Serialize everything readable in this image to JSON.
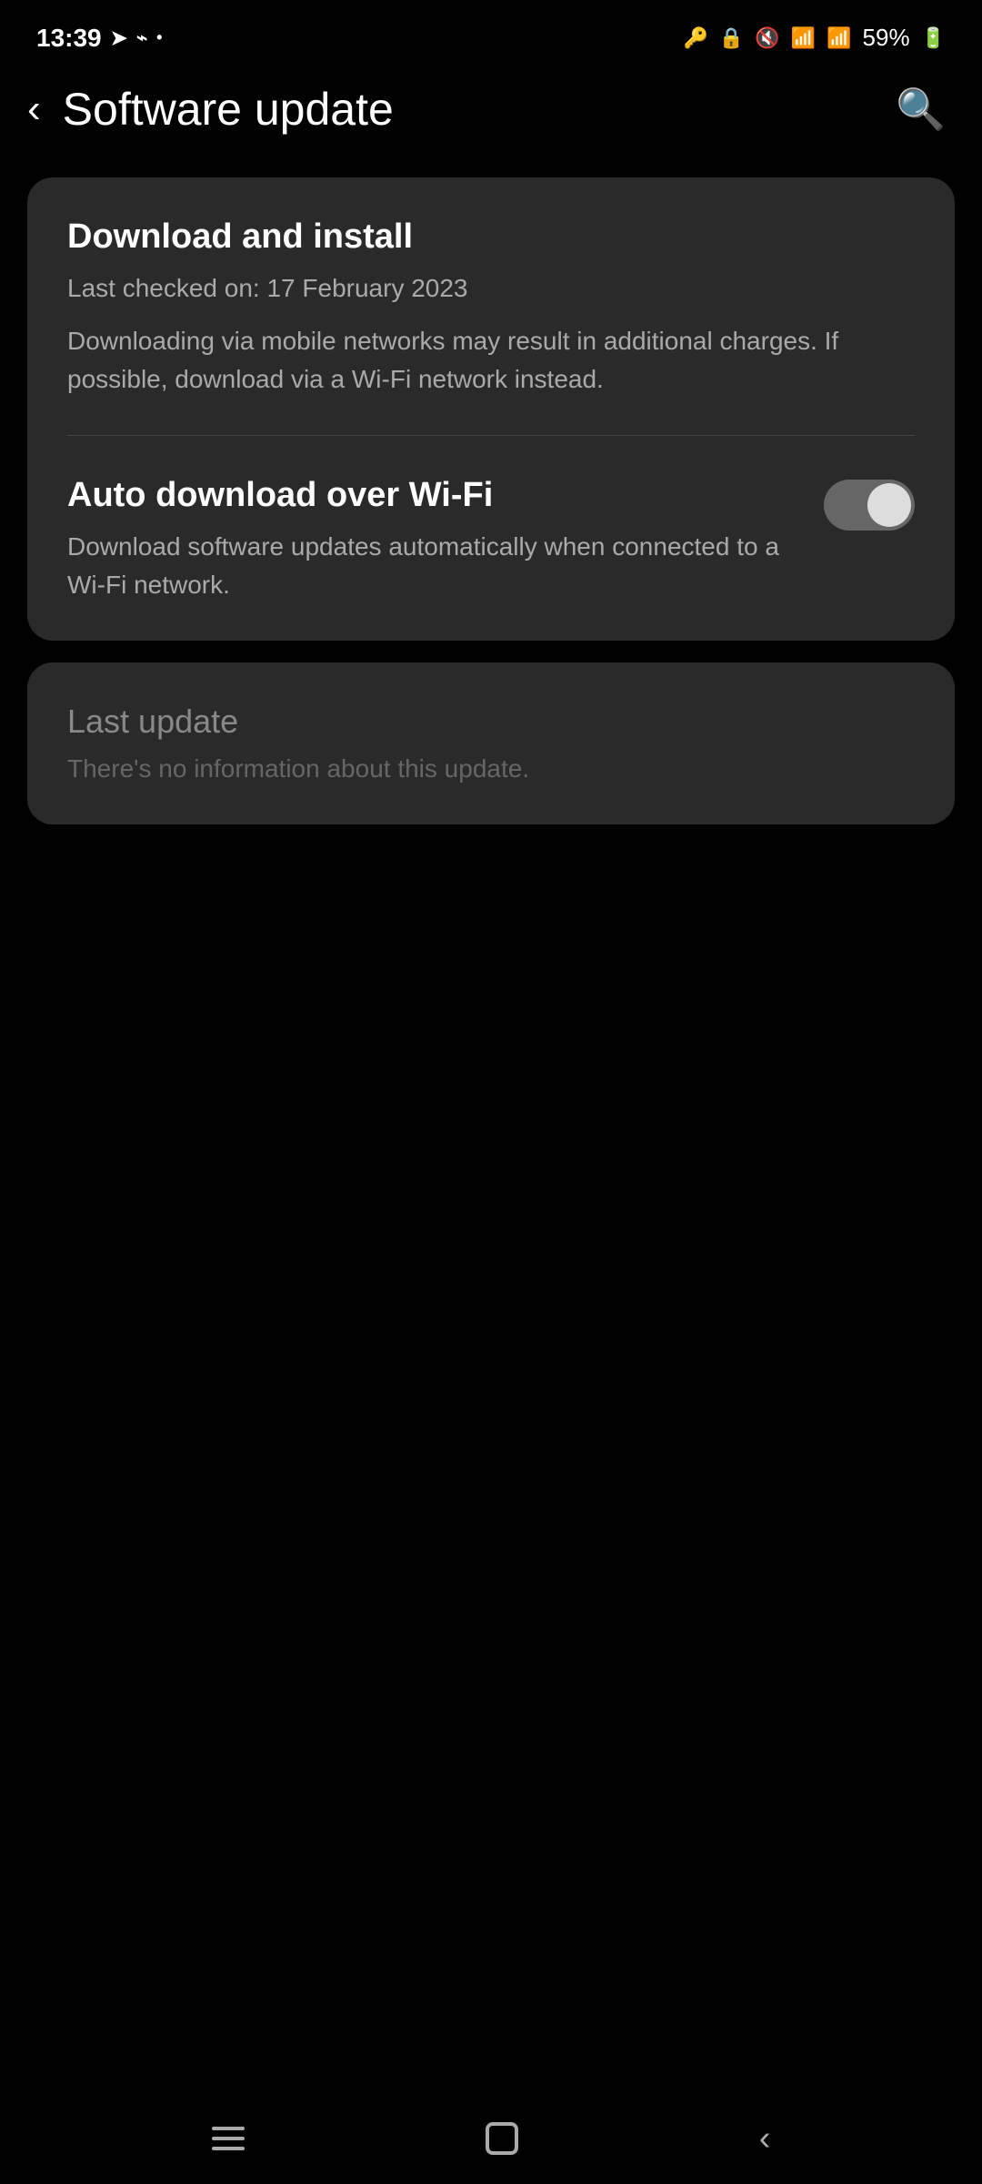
{
  "statusBar": {
    "time": "13:39",
    "battery": "59%"
  },
  "header": {
    "backLabel": "‹",
    "title": "Software update",
    "searchLabel": "⌕"
  },
  "downloadCard": {
    "title": "Download and install",
    "lastCheckedLabel": "Last checked on: 17 February 2023",
    "warningText": "Downloading via mobile networks may result in additional charges. If possible, download via a Wi-Fi network instead."
  },
  "autoDownloadSection": {
    "title": "Auto download over Wi-Fi",
    "description": "Download software updates automatically when connected to a Wi-Fi network.",
    "toggleEnabled": false
  },
  "lastUpdateCard": {
    "title": "Last update",
    "description": "There's no information about this update."
  },
  "bottomNav": {
    "recentsLabel": "Recents",
    "homeLabel": "Home",
    "backLabel": "Back"
  }
}
